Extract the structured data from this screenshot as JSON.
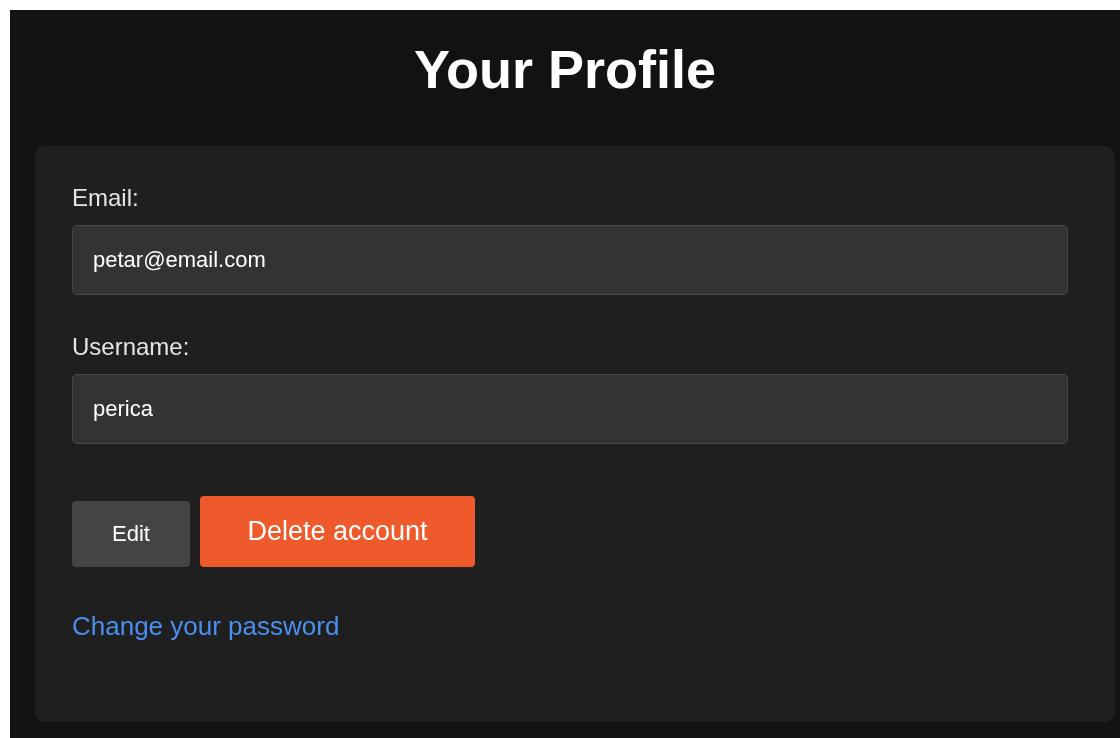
{
  "title": "Your Profile",
  "fields": [
    {
      "label": "Email:",
      "value": "petar@email.com"
    },
    {
      "label": "Username:",
      "value": "perica"
    }
  ],
  "buttons": [
    {
      "kind": "secondary",
      "label": "Edit"
    },
    {
      "kind": "danger",
      "label": "Delete account"
    }
  ],
  "link": "Change your password"
}
